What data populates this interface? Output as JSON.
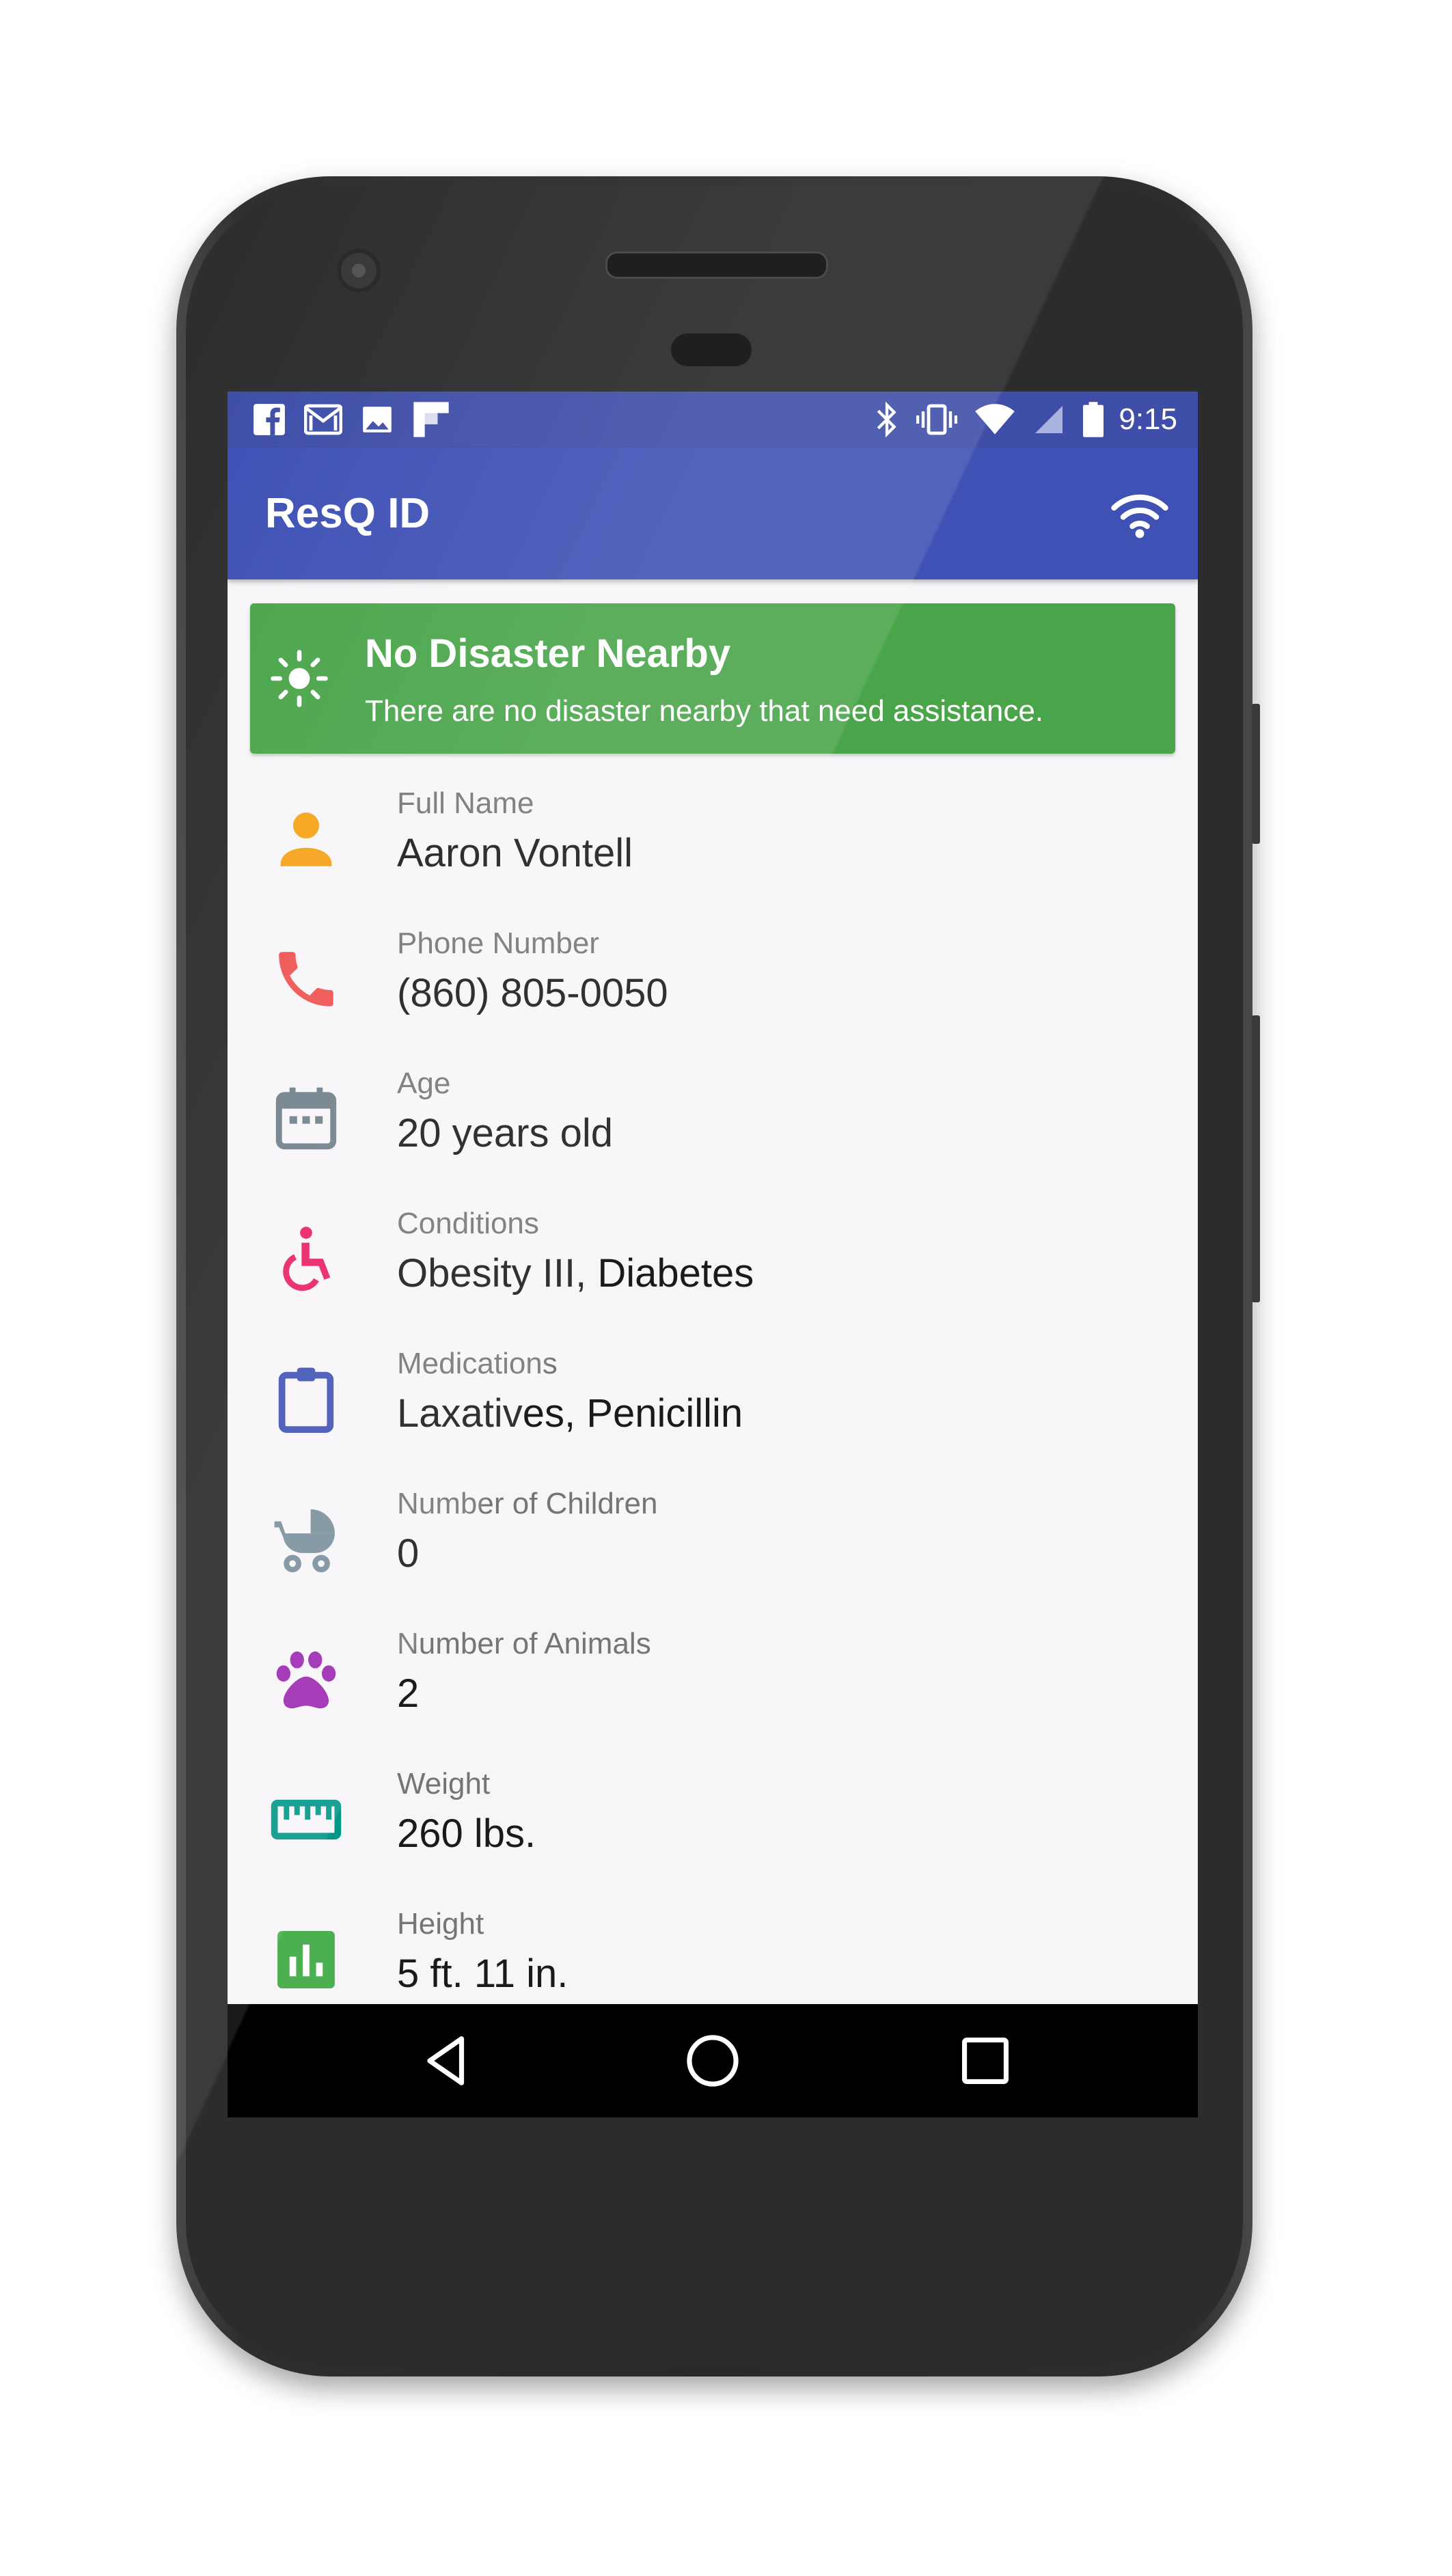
{
  "status_bar": {
    "time": "9:15",
    "left_icons": [
      "facebook-icon",
      "gmail-icon",
      "image-icon",
      "flipboard-icon"
    ],
    "right_icons": [
      "bluetooth-icon",
      "vibrate-icon",
      "wifi-icon",
      "signal-icon",
      "battery-icon"
    ]
  },
  "app_bar": {
    "title": "ResQ ID",
    "action_icon": "wifi-icon"
  },
  "banner": {
    "title": "No Disaster Nearby",
    "message": "There are no disaster nearby that need assistance.",
    "icon": "sun-icon",
    "color": "#4aa54a"
  },
  "fields": [
    {
      "label": "Full Name",
      "value": "Aaron Vontell",
      "icon": "person-icon",
      "color": "#f5a31a"
    },
    {
      "label": "Phone Number",
      "value": "(860) 805-0050",
      "icon": "phone-icon",
      "color": "#ef5350"
    },
    {
      "label": "Age",
      "value": "20 years old",
      "icon": "calendar-icon",
      "color": "#6f7f8a"
    },
    {
      "label": "Conditions",
      "value": "Obesity III, Diabetes",
      "icon": "wheelchair-icon",
      "color": "#e91e63"
    },
    {
      "label": "Medications",
      "value": "Laxatives, Penicillin",
      "icon": "clipboard-icon",
      "color": "#3f51b5"
    },
    {
      "label": "Number of Children",
      "value": "0",
      "icon": "stroller-icon",
      "color": "#78909c"
    },
    {
      "label": "Number of Animals",
      "value": "2",
      "icon": "paw-icon",
      "color": "#9c27b0"
    },
    {
      "label": "Weight",
      "value": "260 lbs.",
      "icon": "ruler-icon",
      "color": "#009688"
    },
    {
      "label": "Height",
      "value": "5 ft. 11 in.",
      "icon": "bar-chart-icon",
      "color": "#4caf50"
    }
  ],
  "nav_bar": {
    "buttons": [
      "back-icon",
      "home-icon",
      "recents-icon"
    ]
  }
}
